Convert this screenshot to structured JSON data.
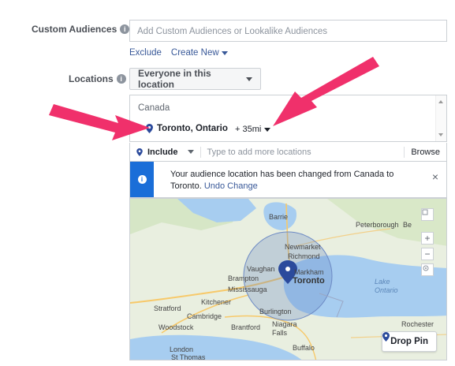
{
  "custom_audiences": {
    "label": "Custom Audiences",
    "placeholder": "Add Custom Audiences or Lookalike Audiences",
    "exclude_link": "Exclude",
    "create_new_link": "Create New"
  },
  "locations": {
    "label": "Locations",
    "dropdown_value": "Everyone in this location",
    "country": "Canada",
    "city": "Toronto, Ontario",
    "radius": "+ 35mi",
    "include_label": "Include",
    "add_placeholder": "Type to add more locations",
    "browse_label": "Browse"
  },
  "notice": {
    "text": "Your audience location has been changed from Canada to Toronto.",
    "undo_label": "Undo Change",
    "close_glyph": "×"
  },
  "map": {
    "place_labels": [
      "Barrie",
      "Peterborough",
      "Newmarket",
      "Richmond",
      "Vaughan",
      "Markham",
      "Toronto",
      "Brampton",
      "Mississauga",
      "Kitchener",
      "Stratford",
      "Cambridge",
      "Burlington",
      "Woodstock",
      "Brantford",
      "Niagara Falls",
      "London",
      "St Thomas",
      "Buffalo",
      "Lake Ontario",
      "Rochester",
      "Be"
    ],
    "zoom_in": "+",
    "zoom_out": "−",
    "drop_pin_label": "Drop Pin"
  },
  "colors": {
    "accent_blue": "#1a6ed8",
    "link_blue": "#385898",
    "arrow_pink": "#f0306b",
    "pin_navy": "#2b4a9c",
    "lake_blue": "#a7cdf0"
  },
  "icons": [
    "info-icon",
    "location-pin-icon",
    "caret-down-icon",
    "close-icon",
    "locate-icon",
    "expand-icon"
  ]
}
